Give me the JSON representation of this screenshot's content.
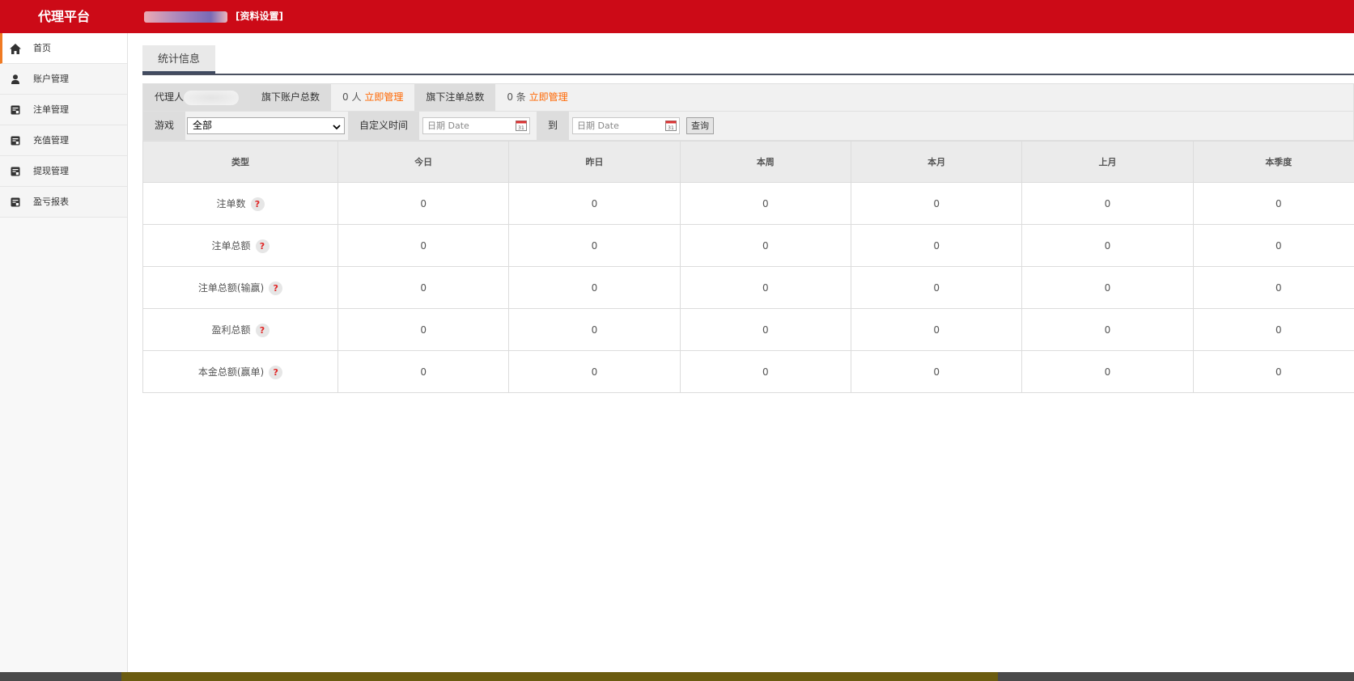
{
  "header": {
    "brand": "代理平台",
    "settings_link": "[资料设置]"
  },
  "sidebar": {
    "items": [
      {
        "label": "首页",
        "icon": "home-icon",
        "active": true
      },
      {
        "label": "账户管理",
        "icon": "user-icon",
        "active": false
      },
      {
        "label": "注单管理",
        "icon": "ledger-icon",
        "active": false
      },
      {
        "label": "充值管理",
        "icon": "ledger-icon",
        "active": false
      },
      {
        "label": "提现管理",
        "icon": "ledger-icon",
        "active": false
      },
      {
        "label": "盈亏报表",
        "icon": "ledger-icon",
        "active": false
      }
    ]
  },
  "tab": {
    "label": "统计信息"
  },
  "info": {
    "agent_label": "代理人",
    "accounts_label": "旗下账户总数",
    "accounts_count": "0 人",
    "manage_link": "立即管理",
    "orders_label": "旗下注单总数",
    "orders_count": "0 条"
  },
  "filter": {
    "game_label": "游戏",
    "game_selected": "全部",
    "custom_time_label": "自定义时间",
    "date_placeholder": "日期 Date",
    "to_label": "到",
    "query_button": "查询"
  },
  "table": {
    "columns": [
      "类型",
      "今日",
      "昨日",
      "本周",
      "本月",
      "上月",
      "本季度"
    ],
    "rows": [
      {
        "label": "注单数",
        "values": [
          "0",
          "0",
          "0",
          "0",
          "0",
          "0"
        ]
      },
      {
        "label": "注单总额",
        "values": [
          "0",
          "0",
          "0",
          "0",
          "0",
          "0"
        ]
      },
      {
        "label": "注单总额(输赢)",
        "values": [
          "0",
          "0",
          "0",
          "0",
          "0",
          "0"
        ]
      },
      {
        "label": "盈利总额",
        "values": [
          "0",
          "0",
          "0",
          "0",
          "0",
          "0"
        ]
      },
      {
        "label": "本金总额(赢单)",
        "values": [
          "0",
          "0",
          "0",
          "0",
          "0",
          "0"
        ]
      }
    ],
    "help_glyph": "?"
  },
  "colors": {
    "header_bg": "#cc0a17",
    "accent_orange": "#ff6600",
    "active_indicator": "#f07a23"
  }
}
